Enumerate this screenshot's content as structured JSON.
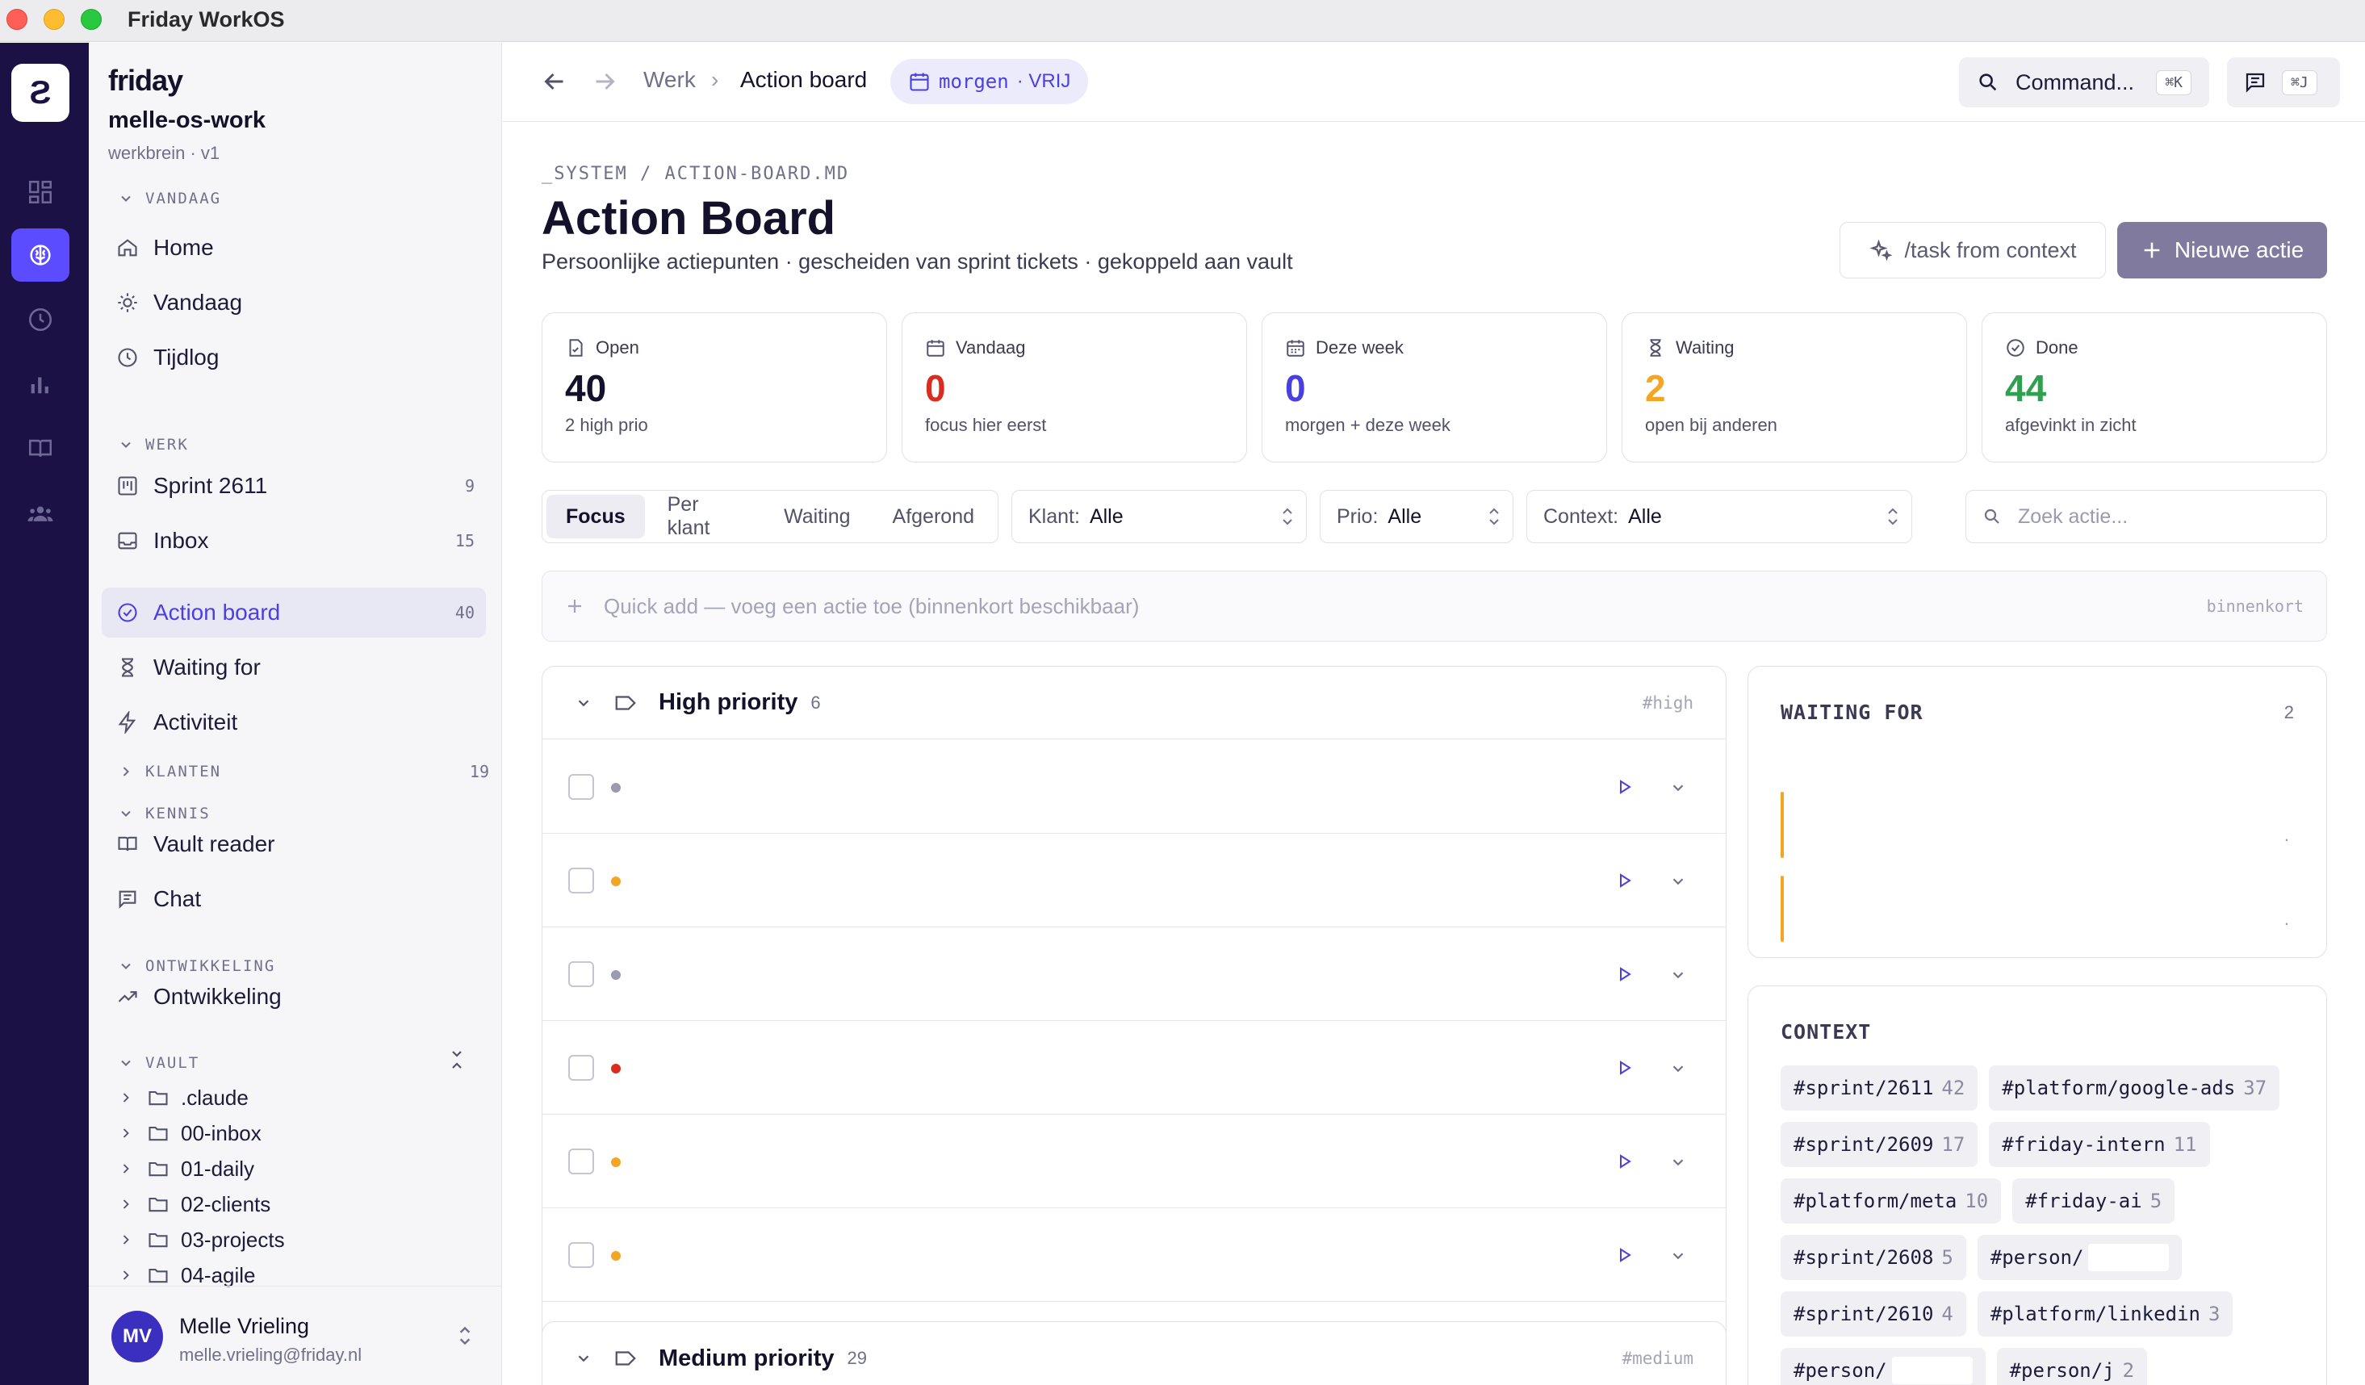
{
  "window": {
    "title": "Friday WorkOS"
  },
  "rail": {
    "logo": "Ƨ"
  },
  "sidebar": {
    "brand": "friday",
    "workspace": "melle-os-work",
    "workspace_sub": "werkbrein · v1",
    "sections": {
      "vandaag": "VANDAAG",
      "werk": "WERK",
      "klanten": "KLANTEN",
      "klanten_count": "19",
      "kennis": "KENNIS",
      "ontwikkeling": "ONTWIKKELING",
      "vault": "VAULT"
    },
    "items": {
      "home": "Home",
      "vandaag": "Vandaag",
      "tijdlog": "Tijdlog",
      "sprint": "Sprint 2611",
      "sprint_count": "9",
      "inbox": "Inbox",
      "inbox_count": "15",
      "action_board": "Action board",
      "action_board_count": "40",
      "waiting": "Waiting for",
      "activiteit": "Activiteit",
      "vault_reader": "Vault reader",
      "chat": "Chat",
      "ontwikkeling": "Ontwikkeling"
    },
    "vault_tree": [
      ".claude",
      "00-inbox",
      "01-daily",
      "02-clients",
      "03-projects",
      "04-agile"
    ],
    "user": {
      "initials": "MV",
      "name": "Melle Vrieling",
      "email": "melle.vrieling@friday.nl"
    }
  },
  "topbar": {
    "crumb_parent": "Werk",
    "crumb_current": "Action board",
    "date_chip": "morgen",
    "date_chip_status": "· VRIJ",
    "command_label": "Command...",
    "command_kbd": "⌘K",
    "chat_kbd": "⌘J"
  },
  "page": {
    "path": "_SYSTEM / ACTION-BOARD.MD",
    "title": "Action Board",
    "subtitle": "Persoonlijke actiepunten · gescheiden van sprint tickets · gekoppeld aan vault",
    "btn_context": "/task from context",
    "btn_new": "Nieuwe actie"
  },
  "stats": [
    {
      "label": "Open",
      "value": "40",
      "sub": "2 high prio",
      "color": "#14112b"
    },
    {
      "label": "Vandaag",
      "value": "0",
      "sub": "focus hier eerst",
      "color": "#d92d20"
    },
    {
      "label": "Deze week",
      "value": "0",
      "sub": "morgen + deze week",
      "color": "#4b3fe0"
    },
    {
      "label": "Waiting",
      "value": "2",
      "sub": "open bij anderen",
      "color": "#f5a524"
    },
    {
      "label": "Done",
      "value": "44",
      "sub": "afgevinkt in zicht",
      "color": "#2ea04f"
    }
  ],
  "filters": {
    "tabs": [
      "Focus",
      "Per klant",
      "Waiting",
      "Afgerond"
    ],
    "klant_label": "Klant:",
    "klant_value": "Alle",
    "prio_label": "Prio:",
    "prio_value": "Alle",
    "context_label": "Context:",
    "context_value": "Alle",
    "search_placeholder": "Zoek actie..."
  },
  "quick_add": {
    "text": "Quick add — voeg een actie toe (binnenkort beschikbaar)",
    "badge": "binnenkort"
  },
  "groups": {
    "high": {
      "title": "High priority",
      "count": "6",
      "hash": "#high",
      "dot_colors": [
        "#9a9ab0",
        "#f5a524",
        "#9a9ab0",
        "#d92d20",
        "#f5a524",
        "#f5a524"
      ]
    },
    "medium": {
      "title": "Medium priority",
      "count": "29",
      "hash": "#medium"
    }
  },
  "waiting_panel": {
    "title": "WAITING FOR",
    "count": "2",
    "dot": "."
  },
  "context_panel": {
    "title": "CONTEXT",
    "chips": [
      {
        "tag": "#sprint/2611",
        "n": "42"
      },
      {
        "tag": "#platform/google-ads",
        "n": "37"
      },
      {
        "tag": "#sprint/2609",
        "n": "17"
      },
      {
        "tag": "#friday-intern",
        "n": "11"
      },
      {
        "tag": "#platform/meta",
        "n": "10"
      },
      {
        "tag": "#friday-ai",
        "n": "5"
      },
      {
        "tag": "#sprint/2608",
        "n": "5"
      },
      {
        "tag": "#person/",
        "n": ""
      },
      {
        "tag": "#sprint/2610",
        "n": "4"
      },
      {
        "tag": "#platform/linkedin",
        "n": "3"
      },
      {
        "tag": "#person/",
        "n": ""
      },
      {
        "tag": "#person/j",
        "n": "2"
      }
    ]
  }
}
